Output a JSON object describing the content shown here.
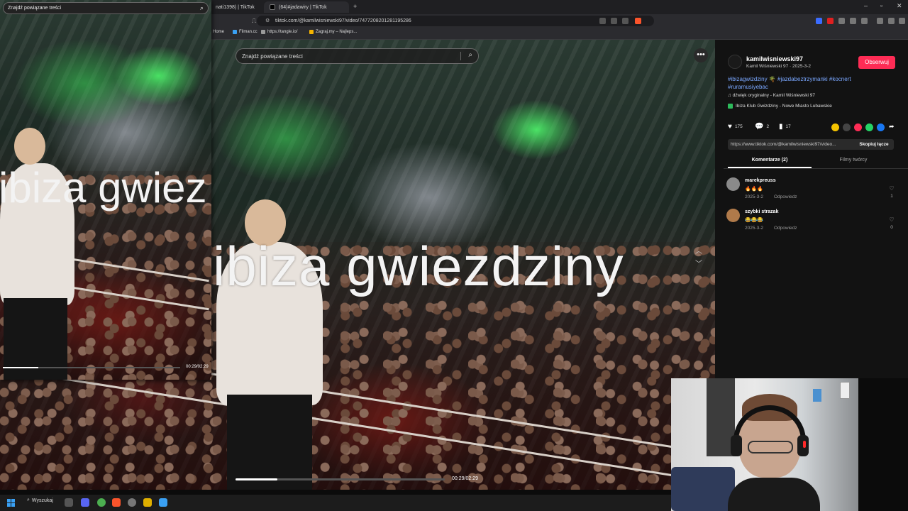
{
  "browser": {
    "tabs": [
      {
        "label": "nati1398) | TikTok"
      },
      {
        "label": "(64)#jadawiry | TikTok"
      }
    ],
    "new_tab": "+",
    "url": "tiktok.com/@kamilwisniewski97/video/7477208201281195286",
    "bookmarks": [
      "Home",
      "Filman.cc",
      "https://tangle.io/",
      "Zagraj.my – Najleps..."
    ],
    "window_controls": [
      "–",
      "▫",
      "✕"
    ]
  },
  "video": {
    "search_placeholder": "Znajdź powiązane treści",
    "overlay_text": "ibiza gwiezdziny",
    "time": "00:29/02:29",
    "progress": 0.2
  },
  "mini_player": {
    "search_placeholder": "Znajdź powiązane treści",
    "overlay_text": "ibiza gwiez",
    "time": "00:29/02:29",
    "progress": 0.2
  },
  "post": {
    "username": "kamilwisniewski97",
    "nick_date": "Kamil Wiśniewski 97 · 2025-3-2",
    "follow_label": "Obserwuj",
    "hashtags": "#ibizagwizdziny 🌴 #jazdabeztrzymanki #kocnert #ruramusiyebac",
    "music": "♫  dźwięk oryginalny - Kamil Wiśniewski 97",
    "location": "Ibiza Klub Gwizdziny - Nowe Miasto Lubawskie",
    "likes": "175",
    "comments": "2",
    "saves": "17",
    "link": "https://www.tiktok.com/@kamilwisniewski97/video...",
    "copy_label": "Skopiuj łącze",
    "tab_comments": "Komentarze (2)",
    "tab_creator": "Filmy twórcy"
  },
  "comments": [
    {
      "name": "marekpreuss",
      "text": "🔥🔥🔥",
      "date": "2025-3-2",
      "reply": "Odpowiedz",
      "likes": "1"
    },
    {
      "name": "szybki strazak",
      "text": "😂😂😂",
      "date": "2025-3-2",
      "reply": "Odpowiedz",
      "likes": "0"
    }
  ],
  "taskbar": {
    "search_label": "Wyszukaj"
  },
  "colors": {
    "accent": "#fe2c55",
    "hashtag": "#7aa7ff"
  }
}
